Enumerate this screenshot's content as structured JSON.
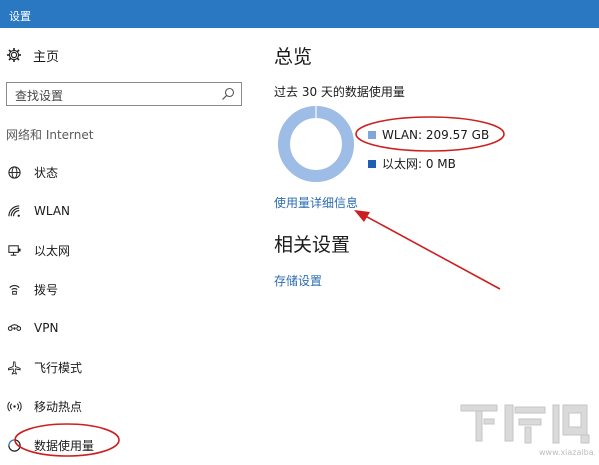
{
  "window": {
    "title": "设置"
  },
  "sidebar": {
    "home_label": "主页",
    "search_placeholder": "查找设置",
    "section_label": "网络和 Internet",
    "items": [
      {
        "label": "状态",
        "icon": "globe-icon"
      },
      {
        "label": "WLAN",
        "icon": "wifi-icon"
      },
      {
        "label": "以太网",
        "icon": "ethernet-icon"
      },
      {
        "label": "拨号",
        "icon": "dialup-icon"
      },
      {
        "label": "VPN",
        "icon": "vpn-icon"
      },
      {
        "label": "飞行模式",
        "icon": "airplane-icon"
      },
      {
        "label": "移动热点",
        "icon": "hotspot-icon"
      },
      {
        "label": "数据使用量",
        "icon": "data-usage-icon",
        "selected": true
      }
    ]
  },
  "main": {
    "overview_heading": "总览",
    "usage_description": "过去 30 天的数据使用量",
    "legend": [
      {
        "label": "WLAN: 209.57 GB",
        "color": "#7fa7dc"
      },
      {
        "label": "以太网: 0 MB",
        "color": "#1f5fb3"
      }
    ],
    "usage_fraction_wlan": 1.0,
    "details_link": "使用量详细信息",
    "related_heading": "相关设置",
    "storage_link": "存储设置"
  },
  "colors": {
    "accent": "#2b78c2",
    "link": "#2b6cb0",
    "annotation": "#cc2020"
  },
  "watermark": {
    "text": "下载吧",
    "url": "www.xiazaiba.com"
  }
}
